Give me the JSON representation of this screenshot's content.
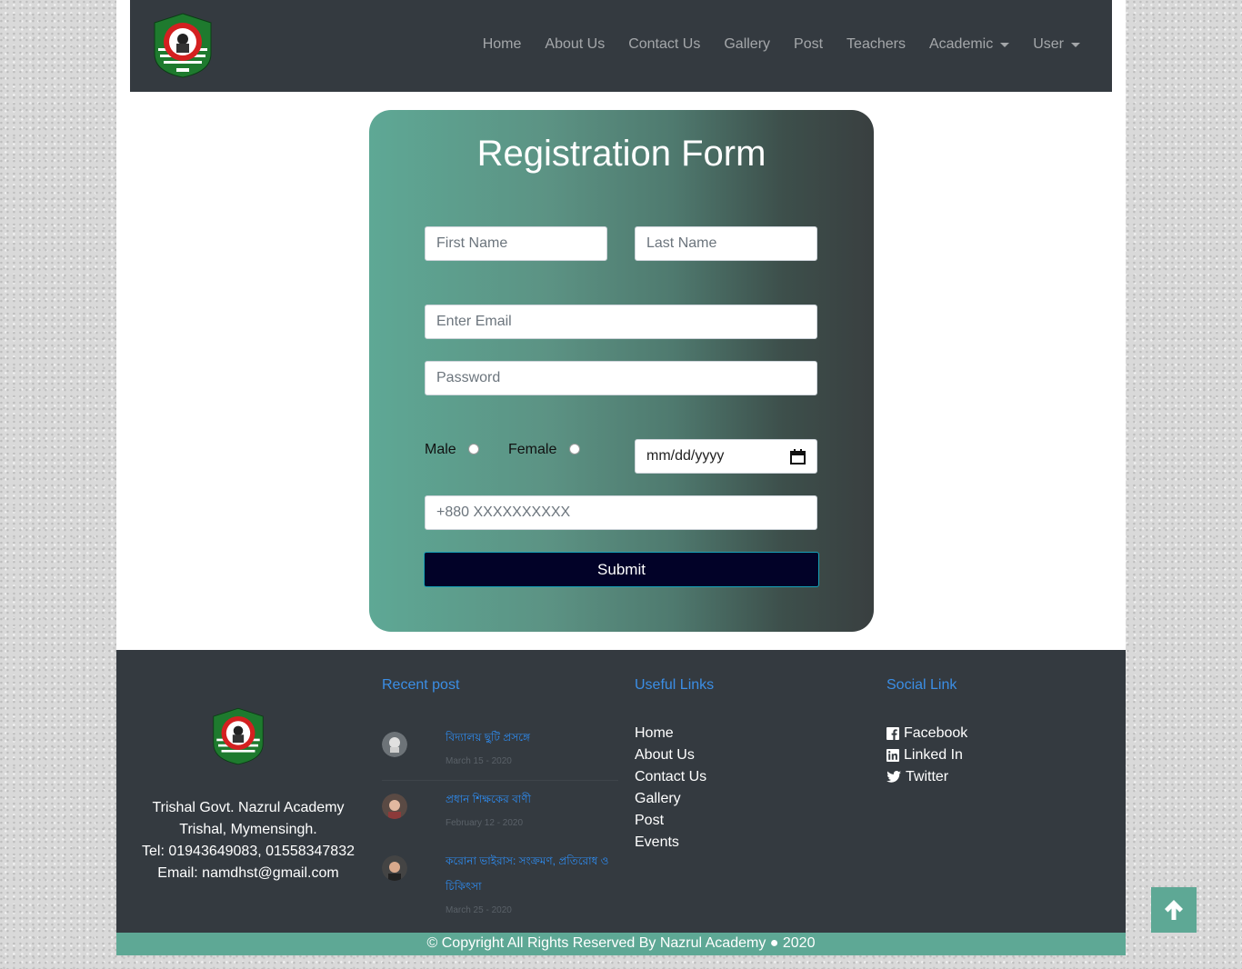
{
  "nav": {
    "logo": "school-logo",
    "items": [
      {
        "label": "Home",
        "dropdown": false
      },
      {
        "label": "About Us",
        "dropdown": false
      },
      {
        "label": "Contact Us",
        "dropdown": false
      },
      {
        "label": "Gallery",
        "dropdown": false
      },
      {
        "label": "Post",
        "dropdown": false
      },
      {
        "label": "Teachers",
        "dropdown": false
      },
      {
        "label": "Academic",
        "dropdown": true
      },
      {
        "label": "User",
        "dropdown": true
      }
    ]
  },
  "form": {
    "title": "Registration Form",
    "first_name_placeholder": "First Name",
    "last_name_placeholder": "Last Name",
    "email_placeholder": "Enter Email",
    "password_placeholder": "Password",
    "gender_male": "Male",
    "gender_female": "Female",
    "date_placeholder": "mm/dd/yyyy",
    "phone_placeholder": "+880 XXXXXXXXXX",
    "submit_label": "Submit"
  },
  "footer": {
    "address": {
      "line1": "Trishal Govt. Nazrul Academy",
      "line2": "Trishal, Mymensingh.",
      "line3": "Tel: 01943649083, 01558347832",
      "line4": "Email: namdhst@gmail.com"
    },
    "recent_heading": "Recent post",
    "recent_posts": [
      {
        "title": "বিদ্যালয় ছুটি প্রসঙ্গে",
        "date": "March 15 - 2020"
      },
      {
        "title": "প্রধান শিক্ষকের বাণী",
        "date": "February 12 - 2020"
      },
      {
        "title": "করোনা ভাইরাস: সংক্রমণ, প্রতিরোধ ও চিকিৎসা",
        "date": "March 25 - 2020"
      }
    ],
    "useful_heading": "Useful Links",
    "useful_links": [
      "Home",
      "About Us",
      "Contact Us",
      "Gallery",
      "Post",
      "Events"
    ],
    "social_heading": "Social Link",
    "social_links": [
      {
        "label": "Facebook",
        "icon": "facebook-icon"
      },
      {
        "label": "Linked In",
        "icon": "linkedin-icon"
      },
      {
        "label": "Twitter",
        "icon": "twitter-icon"
      }
    ],
    "copyright": "© Copyright All Rights Reserved By Nazrul Academy ● 2020"
  },
  "colors": {
    "navbar": "#343a40",
    "accent_green": "#5ea895",
    "link_blue": "#3b8ee5",
    "submit_bg": "#020228"
  }
}
